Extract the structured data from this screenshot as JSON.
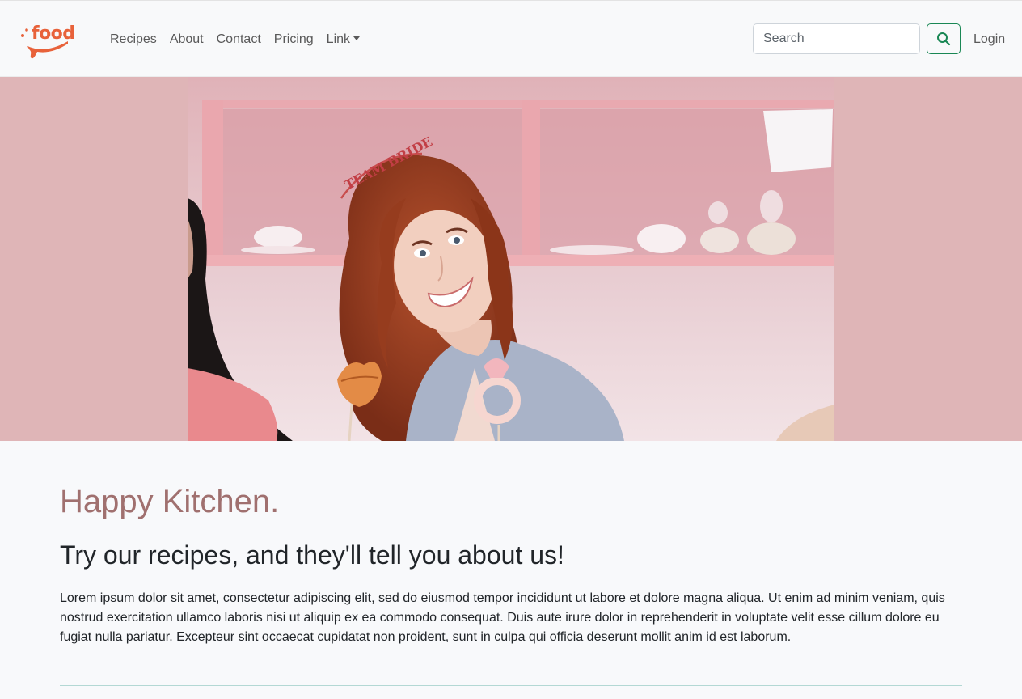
{
  "brand": {
    "logo_text": "food",
    "logo_color": "#e8623a"
  },
  "nav": {
    "links": [
      {
        "label": "Recipes"
      },
      {
        "label": "About"
      },
      {
        "label": "Contact"
      },
      {
        "label": "Pricing"
      },
      {
        "label": "Link"
      }
    ],
    "search_placeholder": "Search",
    "login_label": "Login"
  },
  "hero": {
    "prop_text": "TEAM BRIDE",
    "background_color": "#dfb5b7"
  },
  "content": {
    "headline": "Happy Kitchen.",
    "subheadline": "Try our recipes, and they'll tell you about us!",
    "body": "Lorem ipsum dolor sit amet, consectetur adipiscing elit, sed do eiusmod tempor incididunt ut labore et dolore magna aliqua. Ut enim ad minim veniam, quis nostrud exercitation ullamco laboris nisi ut aliquip ex ea commodo consequat. Duis aute irure dolor in reprehenderit in voluptate velit esse cillum dolore eu fugiat nulla pariatur. Excepteur sint occaecat cupidatat non proident, sunt in culpa qui officia deserunt mollit anim id est laborum."
  },
  "colors": {
    "accent": "#198754",
    "headline": "#a0706f"
  }
}
